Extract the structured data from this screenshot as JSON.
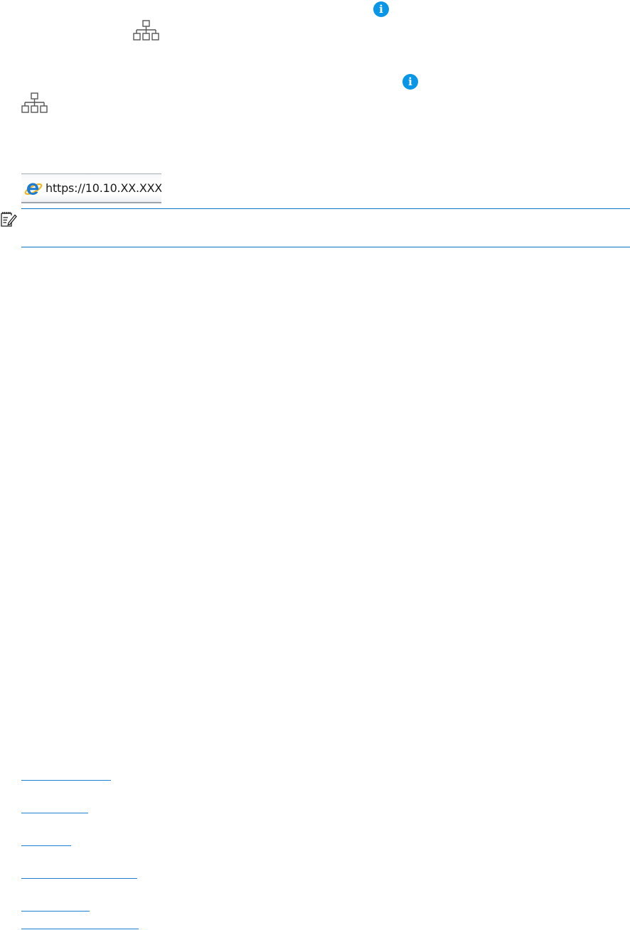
{
  "address_bar": {
    "url": "https://10.10.XX.XXX/"
  },
  "colors": {
    "info_blue": "#0a96e6",
    "rule_blue": "#0a73c4",
    "link_blue": "#1f7fd0",
    "icon_gray": "#555555"
  },
  "icons": {
    "info": "info-icon",
    "network": "network-icon",
    "browser": "internet-explorer-icon",
    "note": "note-icon"
  }
}
